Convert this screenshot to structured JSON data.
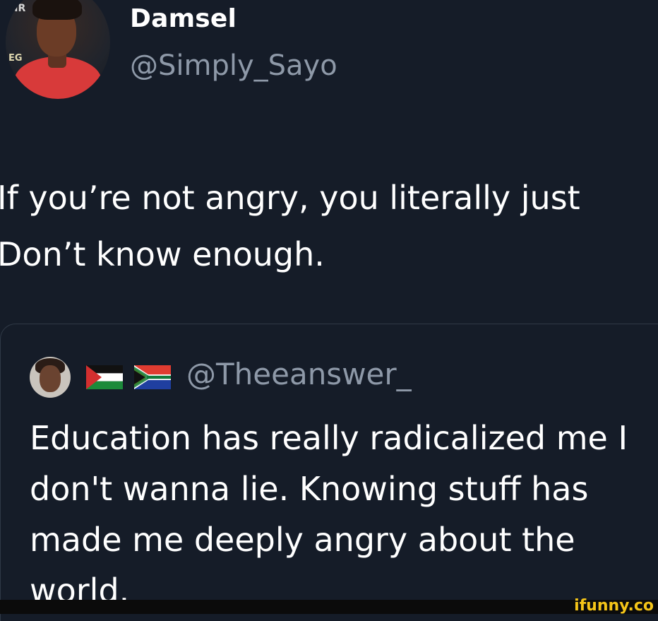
{
  "tweet": {
    "display_name": "Damsel",
    "handle": "@Simply_Sayo",
    "text_lines": [
      "If you’re not angry, you literally just",
      "Don’t know enough."
    ]
  },
  "avatar": {
    "sign_text_top": "CIR",
    "sign_text_left": "EG"
  },
  "quoted_tweet": {
    "handle": "@Theeanswer_",
    "flags": [
      "palestine-flag",
      "south-africa-flag"
    ],
    "text_lines": [
      "Education has really radicalized me I",
      "don't wanna lie. Knowing stuff has",
      "made me deeply angry about the",
      "world."
    ]
  },
  "watermark": {
    "text": "ifunny.co"
  },
  "colors": {
    "background": "#151c28",
    "primary_text": "#ffffff",
    "secondary_text": "#8e99a8",
    "card_border": "#2f3946",
    "watermark": "#f5c518"
  }
}
